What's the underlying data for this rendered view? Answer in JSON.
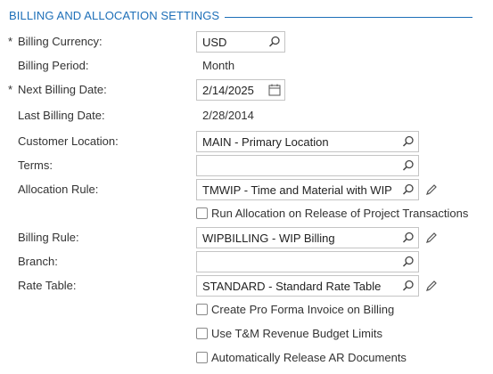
{
  "section": {
    "title": "BILLING AND ALLOCATION SETTINGS"
  },
  "fields": {
    "billing_currency": {
      "label": "Billing Currency:",
      "required": "*",
      "value": "USD",
      "icon": "search-icon"
    },
    "billing_period": {
      "label": "Billing Period:",
      "value": "Month"
    },
    "next_billing_date": {
      "label": "Next Billing Date:",
      "required": "*",
      "value": "2/14/2025",
      "icon": "calendar-icon"
    },
    "last_billing_date": {
      "label": "Last Billing Date:",
      "value": "2/28/2014"
    },
    "customer_location": {
      "label": "Customer Location:",
      "value": "MAIN - Primary Location",
      "icon": "search-icon"
    },
    "terms": {
      "label": "Terms:",
      "value": "",
      "icon": "search-icon"
    },
    "allocation_rule": {
      "label": "Allocation Rule:",
      "value": "TMWIP - Time and Material with WIP",
      "icon": "search-icon",
      "edit_icon": "pencil-icon"
    },
    "billing_rule": {
      "label": "Billing Rule:",
      "value": "WIPBILLING - WIP Billing",
      "icon": "search-icon",
      "edit_icon": "pencil-icon"
    },
    "branch": {
      "label": "Branch:",
      "value": "",
      "icon": "search-icon"
    },
    "rate_table": {
      "label": "Rate Table:",
      "value": "STANDARD - Standard Rate Table",
      "icon": "search-icon",
      "edit_icon": "pencil-icon"
    }
  },
  "checkboxes": {
    "run_allocation": {
      "label": "Run Allocation on Release of Project Transactions",
      "checked": false
    },
    "pro_forma": {
      "label": "Create Pro Forma Invoice on Billing",
      "checked": false
    },
    "tm_revenue_budget": {
      "label": "Use T&M Revenue Budget Limits",
      "checked": false
    },
    "auto_release_ar": {
      "label": "Automatically Release AR Documents",
      "checked": false
    }
  },
  "colors": {
    "accent": "#1d6fb8",
    "border": "#c4c4c4",
    "text": "#333333"
  }
}
